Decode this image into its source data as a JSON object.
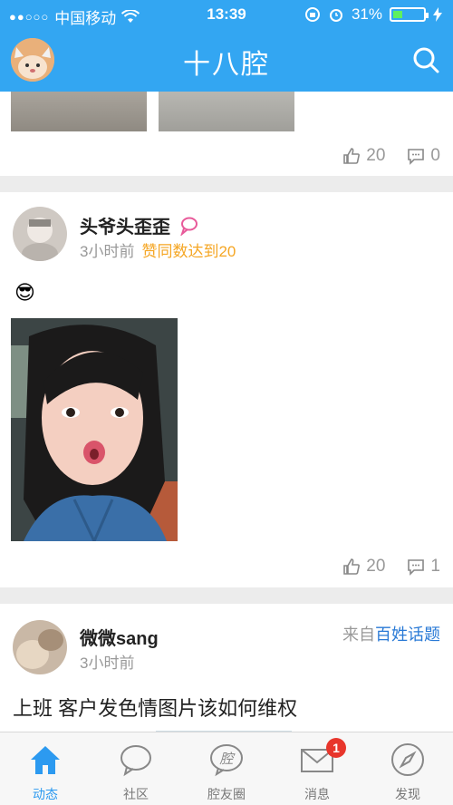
{
  "status_bar": {
    "signal_dots": "●●○○○",
    "carrier": "中国移动",
    "time": "13:39",
    "battery": "31%",
    "battery_fraction": 0.31
  },
  "header": {
    "title": "十八腔"
  },
  "posts": [
    {
      "likes": "20",
      "comments": "0"
    },
    {
      "user": "头爷头歪歪",
      "time": "3小时前",
      "badge": "赞同数达到20",
      "emoji": "😎",
      "likes": "20",
      "comments": "1"
    },
    {
      "user": "微微sang",
      "time": "3小时前",
      "source_prefix": "来自",
      "source_link": "百姓话题",
      "text": "上班 客户发色情图片该如何维权"
    }
  ],
  "tabbar": {
    "items": [
      {
        "label": "动态",
        "icon": "home-icon",
        "active": true
      },
      {
        "label": "社区",
        "icon": "speech-bubble-icon"
      },
      {
        "label": "腔友圈",
        "icon": "qiang-circle-icon",
        "glyph": "腔"
      },
      {
        "label": "消息",
        "icon": "envelope-icon",
        "badge": "1"
      },
      {
        "label": "发现",
        "icon": "compass-icon"
      }
    ]
  },
  "colors": {
    "brand_blue": "#33a6f2",
    "badge_orange": "#f5a623",
    "link_blue": "#2a7ad6",
    "notif_red": "#e8362c"
  }
}
